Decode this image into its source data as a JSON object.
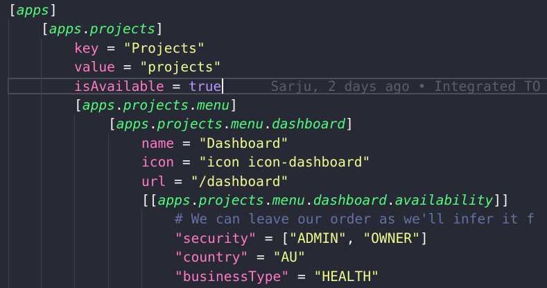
{
  "editor": {
    "blame": "Sarju, 2 days ago • Integrated TO",
    "lines": [
      {
        "indent": 0,
        "tokens": [
          {
            "t": "bracket",
            "v": "["
          },
          {
            "t": "table",
            "v": "apps"
          },
          {
            "t": "bracket",
            "v": "]"
          }
        ]
      },
      {
        "indent": 1,
        "tokens": [
          {
            "t": "bracket",
            "v": "["
          },
          {
            "t": "table",
            "v": "apps"
          },
          {
            "t": "dot",
            "v": "."
          },
          {
            "t": "table",
            "v": "projects"
          },
          {
            "t": "bracket",
            "v": "]"
          }
        ]
      },
      {
        "indent": 2,
        "tokens": [
          {
            "t": "key",
            "v": "key"
          },
          {
            "t": "op",
            "v": " = "
          },
          {
            "t": "str",
            "v": "\"Projects\""
          }
        ]
      },
      {
        "indent": 2,
        "tokens": [
          {
            "t": "key",
            "v": "value"
          },
          {
            "t": "op",
            "v": " = "
          },
          {
            "t": "str",
            "v": "\"projects\""
          }
        ]
      },
      {
        "indent": 2,
        "current": true,
        "tokens": [
          {
            "t": "key",
            "v": "isAvailable"
          },
          {
            "t": "op",
            "v": " = "
          },
          {
            "t": "bool",
            "v": "true"
          }
        ]
      },
      {
        "indent": 2,
        "tokens": [
          {
            "t": "bracket",
            "v": "["
          },
          {
            "t": "table",
            "v": "apps"
          },
          {
            "t": "dot",
            "v": "."
          },
          {
            "t": "table",
            "v": "projects"
          },
          {
            "t": "dot",
            "v": "."
          },
          {
            "t": "table",
            "v": "menu"
          },
          {
            "t": "bracket",
            "v": "]"
          }
        ]
      },
      {
        "indent": 3,
        "tokens": [
          {
            "t": "bracket",
            "v": "["
          },
          {
            "t": "table",
            "v": "apps"
          },
          {
            "t": "dot",
            "v": "."
          },
          {
            "t": "table",
            "v": "projects"
          },
          {
            "t": "dot",
            "v": "."
          },
          {
            "t": "table",
            "v": "menu"
          },
          {
            "t": "dot",
            "v": "."
          },
          {
            "t": "table",
            "v": "dashboard"
          },
          {
            "t": "bracket",
            "v": "]"
          }
        ]
      },
      {
        "indent": 4,
        "tokens": [
          {
            "t": "key",
            "v": "name"
          },
          {
            "t": "op",
            "v": " = "
          },
          {
            "t": "str",
            "v": "\"Dashboard\""
          }
        ]
      },
      {
        "indent": 4,
        "tokens": [
          {
            "t": "key",
            "v": "icon"
          },
          {
            "t": "op",
            "v": " = "
          },
          {
            "t": "str",
            "v": "\"icon icon-dashboard\""
          }
        ]
      },
      {
        "indent": 4,
        "tokens": [
          {
            "t": "key",
            "v": "url"
          },
          {
            "t": "op",
            "v": " = "
          },
          {
            "t": "str",
            "v": "\"/dashboard\""
          }
        ]
      },
      {
        "indent": 4,
        "tokens": [
          {
            "t": "bracket",
            "v": "[["
          },
          {
            "t": "table",
            "v": "apps"
          },
          {
            "t": "dot",
            "v": "."
          },
          {
            "t": "table",
            "v": "projects"
          },
          {
            "t": "dot",
            "v": "."
          },
          {
            "t": "table",
            "v": "menu"
          },
          {
            "t": "dot",
            "v": "."
          },
          {
            "t": "table",
            "v": "dashboard"
          },
          {
            "t": "dot",
            "v": "."
          },
          {
            "t": "table",
            "v": "availability"
          },
          {
            "t": "bracket",
            "v": "]]"
          }
        ]
      },
      {
        "indent": 5,
        "tokens": [
          {
            "t": "comment",
            "v": "# We can leave our order as we'll infer it f"
          }
        ]
      },
      {
        "indent": 5,
        "tokens": [
          {
            "t": "key",
            "v": "\"security\""
          },
          {
            "t": "op",
            "v": " = "
          },
          {
            "t": "bracket",
            "v": "["
          },
          {
            "t": "str",
            "v": "\"ADMIN\""
          },
          {
            "t": "op",
            "v": ", "
          },
          {
            "t": "str",
            "v": "\"OWNER\""
          },
          {
            "t": "bracket",
            "v": "]"
          }
        ]
      },
      {
        "indent": 5,
        "tokens": [
          {
            "t": "key",
            "v": "\"country\""
          },
          {
            "t": "op",
            "v": " = "
          },
          {
            "t": "str",
            "v": "\"AU\""
          }
        ]
      },
      {
        "indent": 5,
        "tokens": [
          {
            "t": "key",
            "v": "\"businessType\""
          },
          {
            "t": "op",
            "v": " = "
          },
          {
            "t": "str",
            "v": "\"HEALTH\""
          }
        ]
      }
    ]
  }
}
